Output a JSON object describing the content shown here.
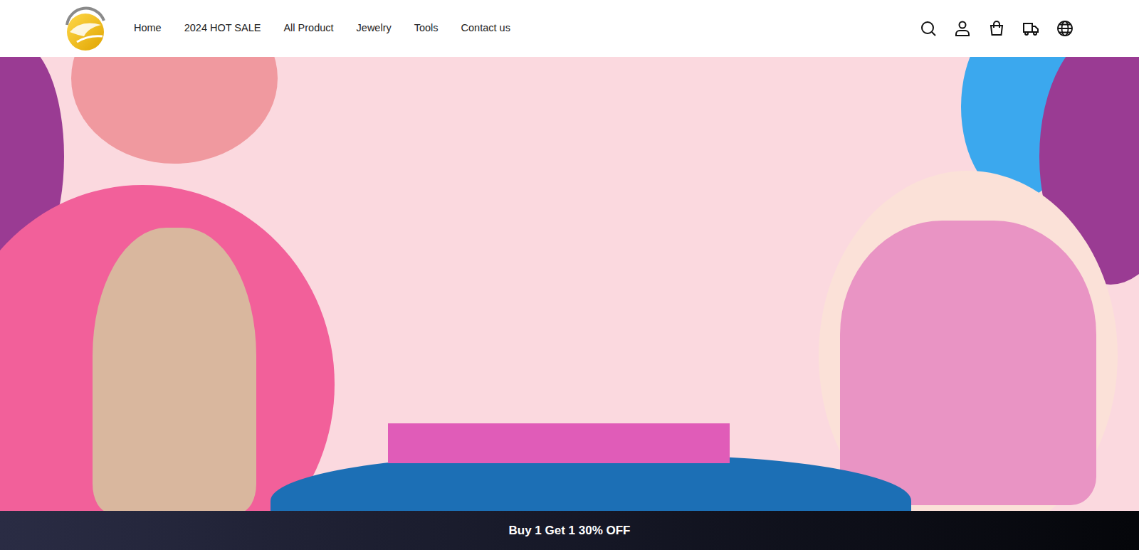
{
  "nav": {
    "items": [
      "Home",
      "2024 HOT SALE",
      "All Product",
      "Jewelry",
      "Tools",
      "Contact us"
    ]
  },
  "announcement": {
    "text": "Buy 1 Get 1 30% OFF"
  }
}
